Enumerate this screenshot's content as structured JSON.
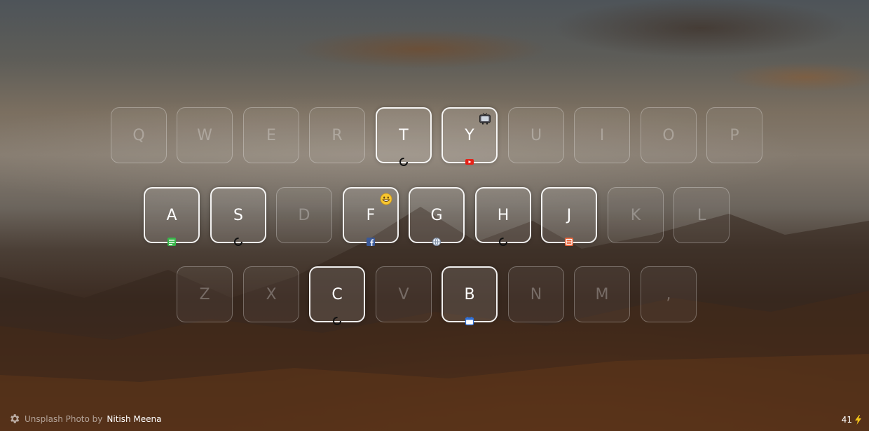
{
  "keyboard": {
    "rows": [
      {
        "keys": [
          {
            "letter": "Q",
            "active": false
          },
          {
            "letter": "W",
            "active": false
          },
          {
            "letter": "E",
            "active": false
          },
          {
            "letter": "R",
            "active": false
          },
          {
            "letter": "T",
            "active": true,
            "favicon": "spinner-icon"
          },
          {
            "letter": "Y",
            "active": true,
            "favicon": "youtube-icon",
            "badge": "tv-emoji-icon"
          },
          {
            "letter": "U",
            "active": false
          },
          {
            "letter": "I",
            "active": false
          },
          {
            "letter": "O",
            "active": false
          },
          {
            "letter": "P",
            "active": false
          }
        ]
      },
      {
        "keys": [
          {
            "letter": "A",
            "active": true,
            "favicon": "green-app-icon"
          },
          {
            "letter": "S",
            "active": true,
            "favicon": "spinner-icon"
          },
          {
            "letter": "D",
            "active": false
          },
          {
            "letter": "F",
            "active": true,
            "favicon": "facebook-icon",
            "badge": "smile-emoji-icon"
          },
          {
            "letter": "G",
            "active": true,
            "favicon": "globe-icon"
          },
          {
            "letter": "H",
            "active": true,
            "favicon": "spinner-icon"
          },
          {
            "letter": "J",
            "active": true,
            "favicon": "orange-app-icon"
          },
          {
            "letter": "K",
            "active": false
          },
          {
            "letter": "L",
            "active": false
          }
        ]
      },
      {
        "keys": [
          {
            "letter": "Z",
            "active": false
          },
          {
            "letter": "X",
            "active": false
          },
          {
            "letter": "C",
            "active": true,
            "favicon": "spinner-icon"
          },
          {
            "letter": "V",
            "active": false
          },
          {
            "letter": "B",
            "active": true,
            "favicon": "calendar-icon"
          },
          {
            "letter": "N",
            "active": false
          },
          {
            "letter": "M",
            "active": false
          },
          {
            "letter": ",",
            "active": false
          }
        ]
      }
    ]
  },
  "footer": {
    "settings_icon": "gear-icon",
    "credit_prefix": "Unsplash Photo by",
    "photographer": "Nitish Meena",
    "count": "41",
    "count_icon": "lightning-bolt-icon",
    "count_icon_color": "#f5c518"
  }
}
